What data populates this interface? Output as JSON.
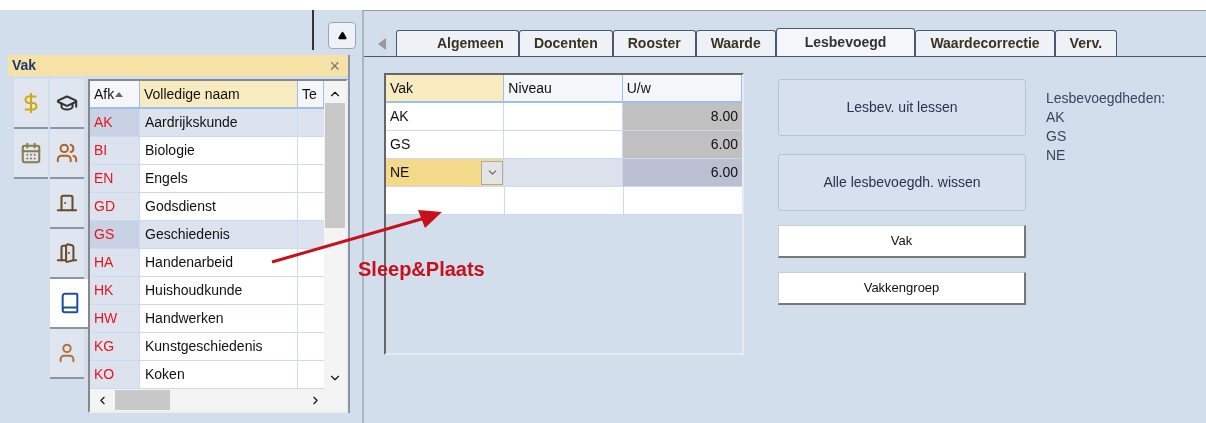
{
  "panel": {
    "title": "Vak",
    "close": "×",
    "side_tabs": [
      {
        "kind": "money",
        "selected": false
      },
      {
        "kind": "schedule",
        "selected": false
      },
      {
        "kind": "teacher",
        "selected": false
      },
      {
        "kind": "group",
        "selected": false
      },
      {
        "kind": "room",
        "selected": false
      },
      {
        "kind": "rooms",
        "selected": false
      },
      {
        "kind": "subject",
        "selected": true
      },
      {
        "kind": "person",
        "selected": false
      }
    ],
    "list": {
      "columns": [
        {
          "label": "Afk",
          "sorted": true,
          "selected": false
        },
        {
          "label": "Volledige naam",
          "sorted": false,
          "selected": true
        },
        {
          "label": "Te",
          "sorted": false,
          "selected": false
        }
      ],
      "rows": [
        {
          "code": "AK",
          "name": "Aardrijkskunde",
          "selected": true
        },
        {
          "code": "BI",
          "name": "Biologie",
          "selected": false
        },
        {
          "code": "EN",
          "name": "Engels",
          "selected": false
        },
        {
          "code": "GD",
          "name": "Godsdienst",
          "selected": false
        },
        {
          "code": "GS",
          "name": "Geschiedenis",
          "selected": true
        },
        {
          "code": "HA",
          "name": "Handenarbeid",
          "selected": false
        },
        {
          "code": "HK",
          "name": "Huishoudkunde",
          "selected": false
        },
        {
          "code": "HW",
          "name": "Handwerken",
          "selected": false
        },
        {
          "code": "KG",
          "name": "Kunstgeschiedenis",
          "selected": false
        },
        {
          "code": "KO",
          "name": "Koken",
          "selected": false
        }
      ]
    }
  },
  "annotation": {
    "label": "Sleep&Plaats"
  },
  "tabs": [
    {
      "label": "Algemeen",
      "selected": false
    },
    {
      "label": "Docenten",
      "selected": false
    },
    {
      "label": "Rooster",
      "selected": false
    },
    {
      "label": "Waarde",
      "selected": false
    },
    {
      "label": "Lesbevoegd",
      "selected": true
    },
    {
      "label": "Waardecorrectie",
      "selected": false
    },
    {
      "label": "Verv.",
      "selected": false
    }
  ],
  "grid": {
    "columns": [
      "Vak",
      "Niveau",
      "U/w"
    ],
    "rows": [
      {
        "vak": "AK",
        "uw": "8.00",
        "editing": false
      },
      {
        "vak": "GS",
        "uw": "6.00",
        "editing": false
      },
      {
        "vak": "NE",
        "uw": "6.00",
        "editing": true
      }
    ]
  },
  "buttons": [
    {
      "label": "Lesbev. uit lessen",
      "kind": "large"
    },
    {
      "label": "Alle lesbevoegdh. wissen",
      "kind": "large"
    },
    {
      "label": "Vak",
      "kind": "small"
    },
    {
      "label": "Vakkengroep",
      "kind": "small"
    }
  ],
  "info": {
    "title": "Lesbevoegdheden:",
    "items": [
      "AK",
      "GS",
      "NE"
    ]
  }
}
